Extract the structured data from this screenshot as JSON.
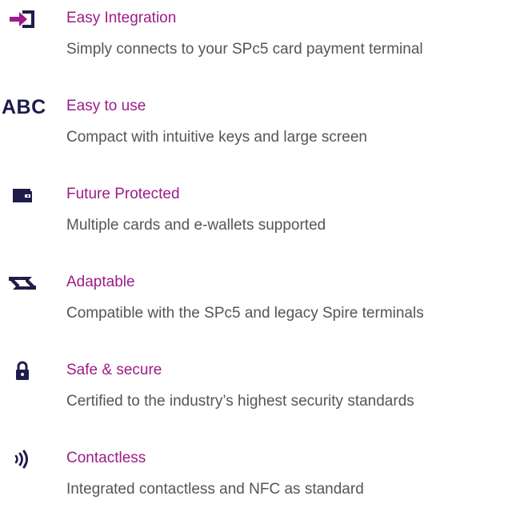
{
  "colors": {
    "title": "#9c1c88",
    "description": "#555555",
    "icon": "#1f1c4a",
    "icon_accent": "#9c1c88"
  },
  "features": [
    {
      "icon": "arrow-into-box-icon",
      "title": "Easy Integration",
      "description": "Simply connects to your SPc5 card payment terminal"
    },
    {
      "icon": "abc-text-icon",
      "icon_text": "ABC",
      "title": "Easy to use",
      "description": "Compact with intuitive keys and large screen"
    },
    {
      "icon": "wallet-icon",
      "title": "Future Protected",
      "description": "Multiple cards and e-wallets supported"
    },
    {
      "icon": "swap-arrows-icon",
      "title": "Adaptable",
      "description": "Compatible with the SPc5 and legacy Spire terminals"
    },
    {
      "icon": "padlock-icon",
      "title": "Safe & secure",
      "description": "Certified to the industry’s highest security standards"
    },
    {
      "icon": "contactless-icon",
      "title": "Contactless",
      "description": "Integrated contactless and NFC as standard"
    }
  ]
}
